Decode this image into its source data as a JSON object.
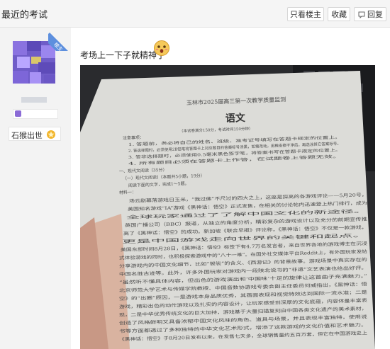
{
  "header": {
    "title": "最近的考试",
    "buttons": {
      "only_author": "只看楼主",
      "favorite": "收藏",
      "reply": "回复"
    }
  },
  "sidebar": {
    "ribbon": "楼主",
    "level_name": "石猴出世"
  },
  "post": {
    "text": "考场上一下子就精神了",
    "photo": {
      "exam_title": "玉林市2025届高三第一次教学质量监测",
      "subject": "语文",
      "subtitle": "（本试卷满分150分，考试时间150分钟）",
      "notice_head": "注意事项：",
      "notice": [
        "1. 答题前，务必将自己的姓名、班级、准考证号填写在答题卡规定的位置上。",
        "2. 答选择题时，必须使用2B铅笔将答题卡上对应题目的答案标号涂黑，如需改动，用橡皮擦干净后，再选涂其它答案标号。",
        "3. 答非选择题时，必须使用0.5毫米黑色签字笔，将答案书写在答题卡规定的位置上。",
        "4. 所有题目必须在答题卡上作答，在试题卷上答题无效。"
      ],
      "section1": "一、现代文阅读（35分）",
      "section1a": "（一）现代文阅读Ⅰ（本题共5小题，19分）",
      "instruction": "阅读下面的文字，完成1～5题。",
      "material": "材料一：",
      "body": [
        "场云剧幕落游戏日玉米，“我过佛”不尺过的四大之上，这座是探高的各游戏评论——5月20号，",
        "美国知名游戏“IA”游戏《黑神话：悟空》正式发售，在相关的讨论帖内迅速登上热门排行，成为",
        "全球玩家通过了了解中国文化的新途径。",
        "英国广播公司（BBC）报道，从独立的角度分析，精彩复杂的游戏设计以及充分的前期宣传推",
        "高了《黑神话：悟空》的成功。新加坡《联合早报》评论称，《黑神话：悟空》不仅是一款游戏，",
        "更是中国游戏走向世界的关键和起点。",
        "美国东部时间8月28日，《黑神话：悟空》标签下有4.7万名发言者，来自世界各地的游戏博主在沉浸",
        "式体验游戏的同时，也积极探索游戏中的“八十一难”。在国外社交媒体平台Reddit上，有外国玩家发帖",
        "分享游戏内的中国文化细节，比如“袈裟”的含义、《西游记》的背景故事。游戏场景中真实存在的",
        "中国名胜古迹等。此外，许多外国玩家对游戏内一段陕北说书的“非遗”文艺表演也给出好评。",
        "“虽然听不懂具体内容，但出色的游戏演出和‘中国味’十足的旋律让这首曲子充满魅力。”",
        "北京师范大学艺术与传媒学院教授、中国音数协游戏专委会副主任委员何威指出，《黑神话：悟",
        "空》的“出圈”原因，一是游戏本身品质优秀，其画面表现和视觉特效达到国际一流水准；二是",
        "游戏，精彩出色的动作游戏以及扎实的内容设计，让玩家感受到深厚的文化底蕴，内容体量丰富表",
        "现，二是中华优秀传统文化的巨大加持，游戏基于大量扫描复刻自中国各类文化遗产的美术素材，",
        "创造了风格鲜明又具备浓郁中国文化风味的角色、道具与场景，并且表现丰富独特，使用说",
        "书等方面都透过了多种独特的中华文化艺术形式，增添了这款游戏的文化价值和艺术魅力。",
        "《黑神话：悟空》于8月20日发布以来，在发售七天多，全球销售量约五百万套，但它在中国游戏史上"
      ]
    }
  },
  "colors": {
    "ribbon": "#5d8fde",
    "avatar": "#6f5cc8"
  },
  "icons": [
    "reply-icon",
    "surprised-emoji-icon",
    "medal-icon"
  ]
}
